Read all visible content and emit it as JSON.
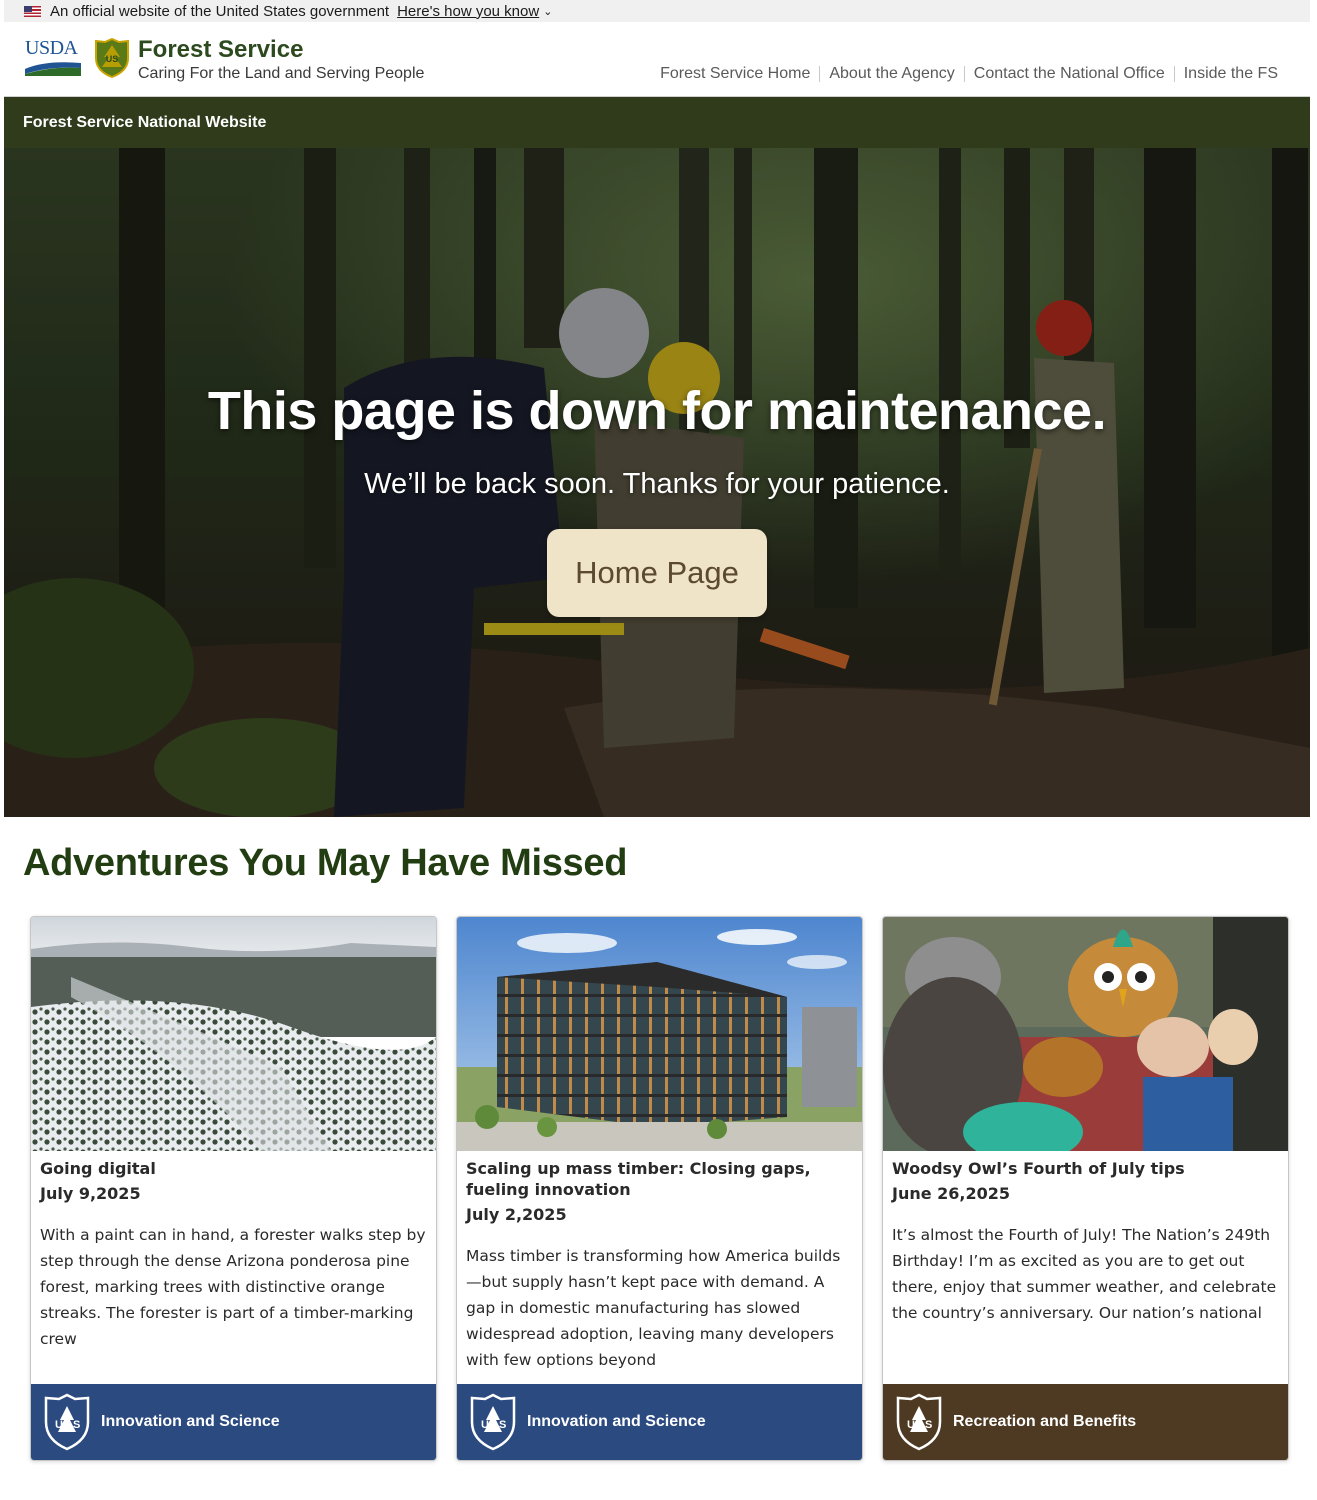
{
  "gov_banner": {
    "text": "An official website of the United States government",
    "link": "Here's how you know"
  },
  "header": {
    "usda_label": "USDA",
    "shield_label": "US",
    "brand_name": "Forest Service",
    "tagline": "Caring For the Land and Serving People",
    "nav": [
      "Forest Service Home",
      "About the Agency",
      "Contact the National Office",
      "Inside the FS"
    ]
  },
  "site_bar": {
    "label": "Forest Service National Website"
  },
  "hero": {
    "title": "This page is down for maintenance.",
    "subtitle": "We’ll be back soon. Thanks for your patience.",
    "button": "Home Page"
  },
  "section": {
    "title": "Adventures You May Have Missed",
    "cards": [
      {
        "title": "Going digital",
        "date": "July 9,2025",
        "text": "With a paint can in hand, a forester walks step by step through the dense Arizona ponderosa pine forest, marking trees with distinctive orange streaks. The forester is part of a timber-marking crew",
        "category": "Innovation and Science",
        "color": "#2b4a80"
      },
      {
        "title": "Scaling up mass timber: Closing gaps, fueling innovation",
        "date": "July 2,2025",
        "text": "Mass timber is transforming how America builds—but supply hasn’t kept pace with demand. A gap in domestic manufacturing has slowed widespread adoption, leaving many developers with few options beyond",
        "category": "Innovation and Science",
        "color": "#2b4a80"
      },
      {
        "title": "Woodsy Owl’s Fourth of July tips",
        "date": "June 26,2025",
        "text": "It’s almost the Fourth of July! The Nation’s 249th Birthday! I’m as excited as you are to get out there, enjoy that summer weather, and celebrate the country’s anniversary. Our nation’s national",
        "category": "Recreation and Benefits",
        "color": "#4e3a22"
      }
    ]
  }
}
